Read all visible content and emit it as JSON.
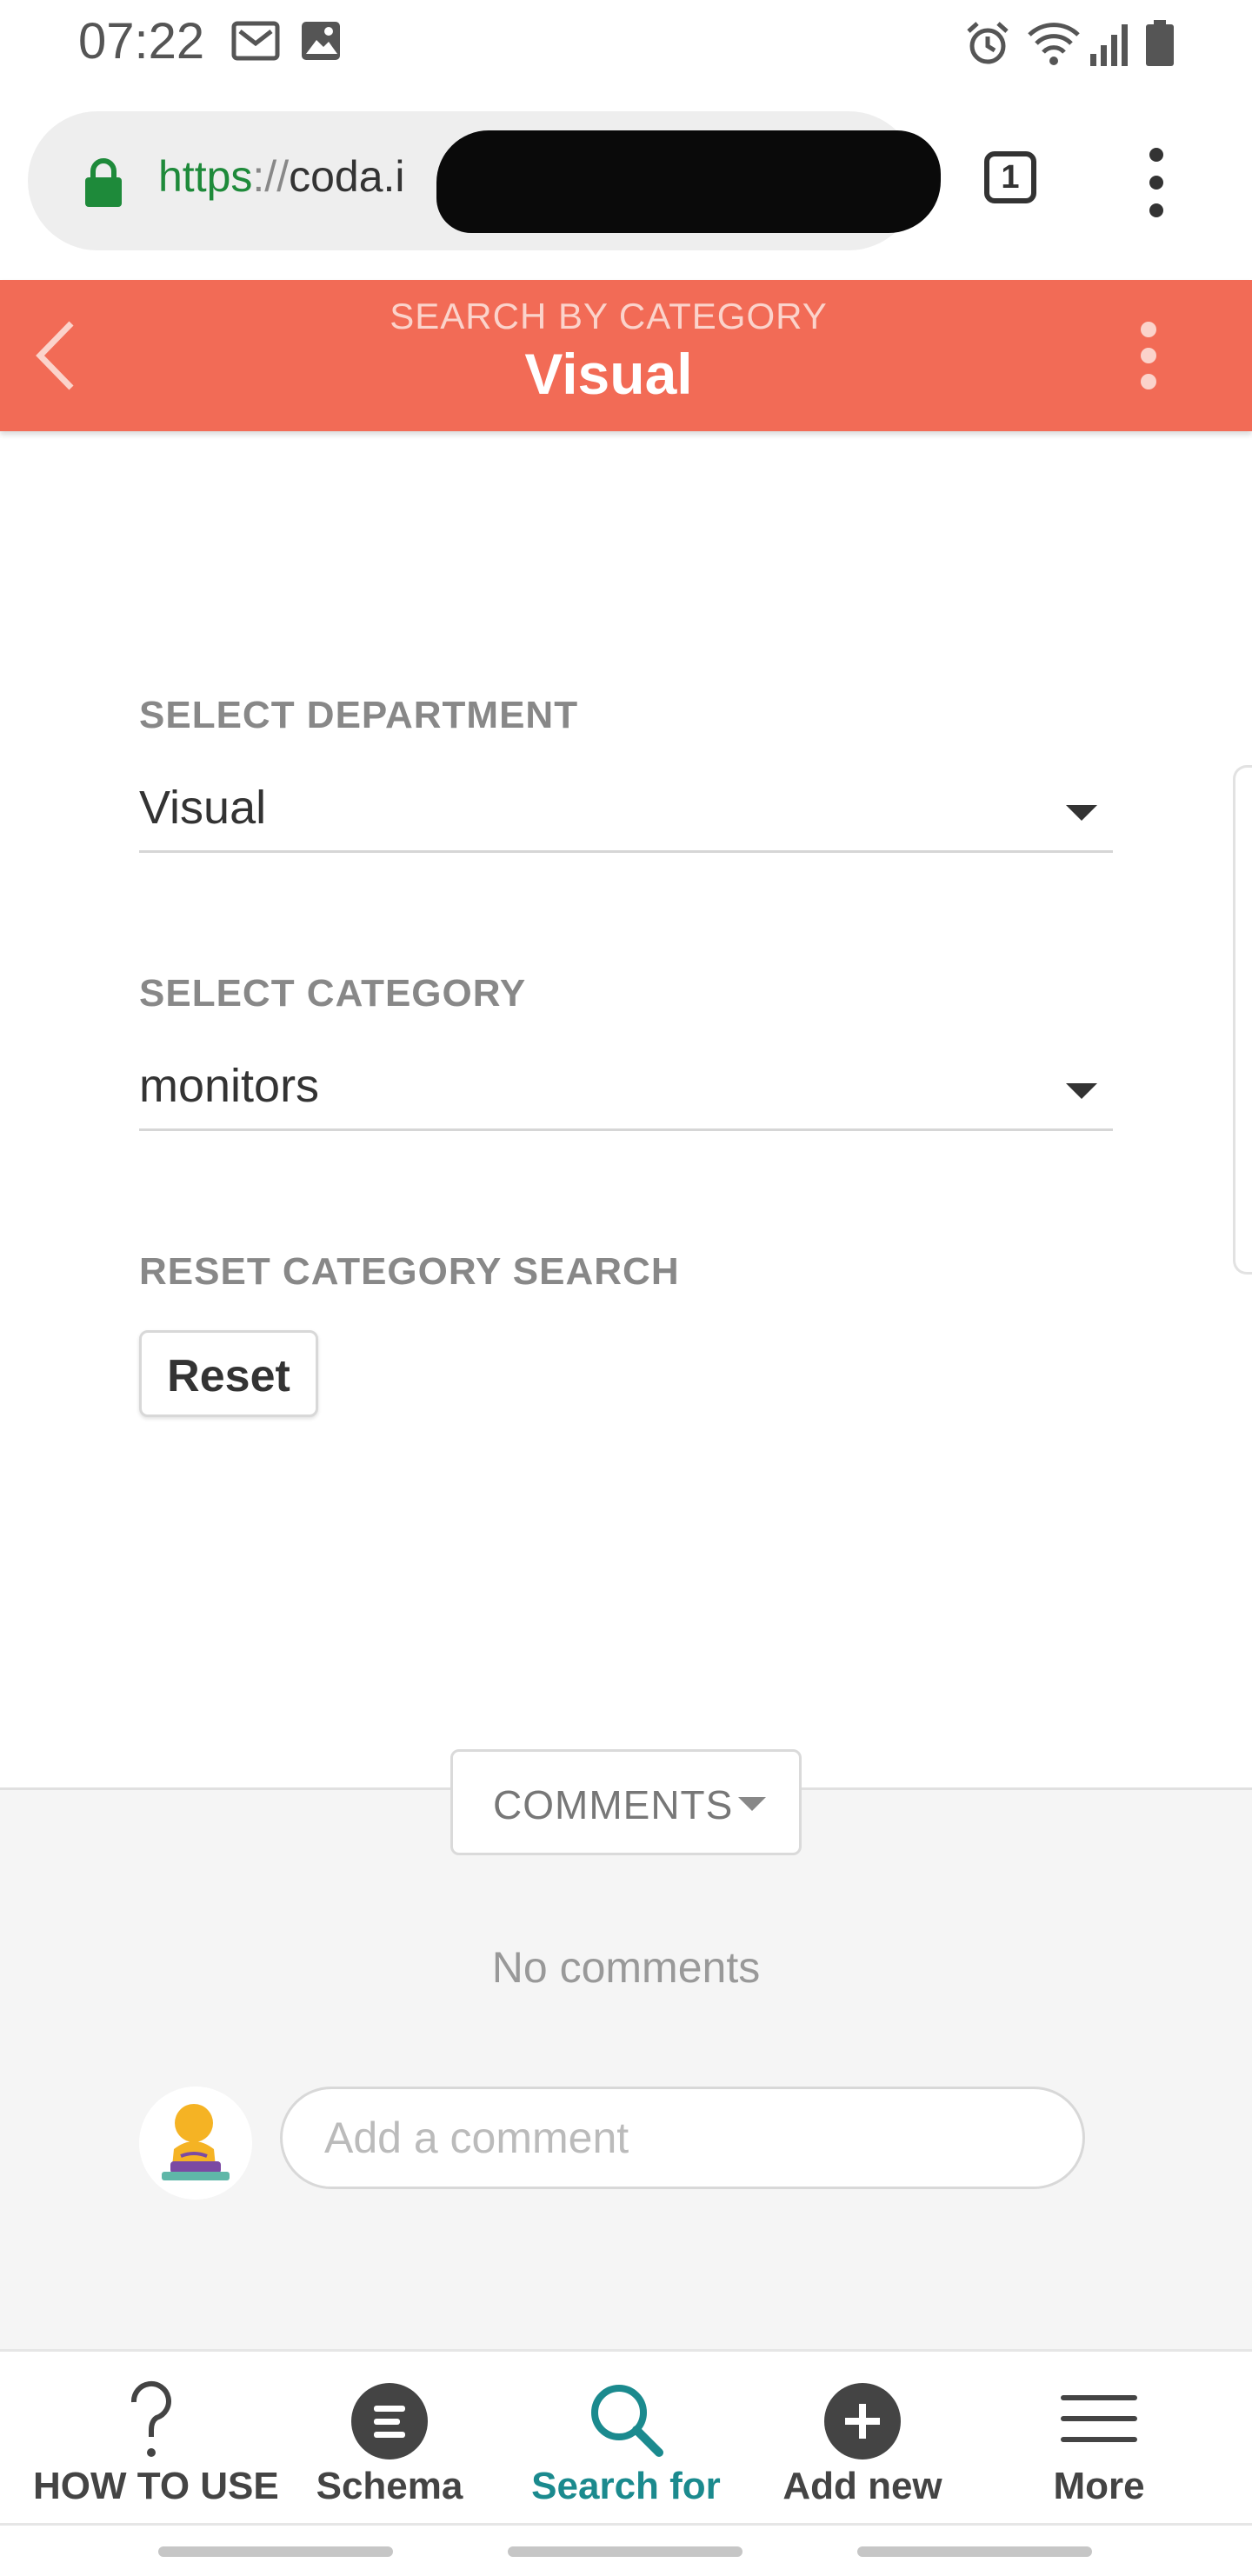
{
  "status_bar": {
    "time": "07:22",
    "left_icons": [
      "gmail-icon",
      "image-icon"
    ],
    "right_icons": [
      "alarm-icon",
      "wifi-icon",
      "signal-icon",
      "battery-icon"
    ]
  },
  "browser": {
    "url_scheme": "https",
    "url_separator": "://",
    "url_host_visible": "coda.i",
    "tabs_count": "1"
  },
  "header": {
    "subtitle": "SEARCH BY CATEGORY",
    "title": "Visual",
    "accent_color": "#f26b56"
  },
  "form": {
    "department_label": "SELECT DEPARTMENT",
    "department_value": "Visual",
    "category_label": "SELECT CATEGORY",
    "category_value": "monitors",
    "reset_label": "RESET CATEGORY SEARCH",
    "reset_button": "Reset"
  },
  "comments": {
    "toggle_label": "COMMENTS",
    "empty_text": "No comments",
    "input_placeholder": "Add a comment"
  },
  "bottom_nav": {
    "active_color": "#1b8a8e",
    "items": [
      {
        "label": "HOW TO USE",
        "icon": "question-icon"
      },
      {
        "label": "Schema",
        "icon": "list-icon"
      },
      {
        "label": "Search for",
        "icon": "search-icon",
        "active": true
      },
      {
        "label": "Add new",
        "icon": "add-icon"
      },
      {
        "label": "More",
        "icon": "menu-icon"
      }
    ]
  }
}
